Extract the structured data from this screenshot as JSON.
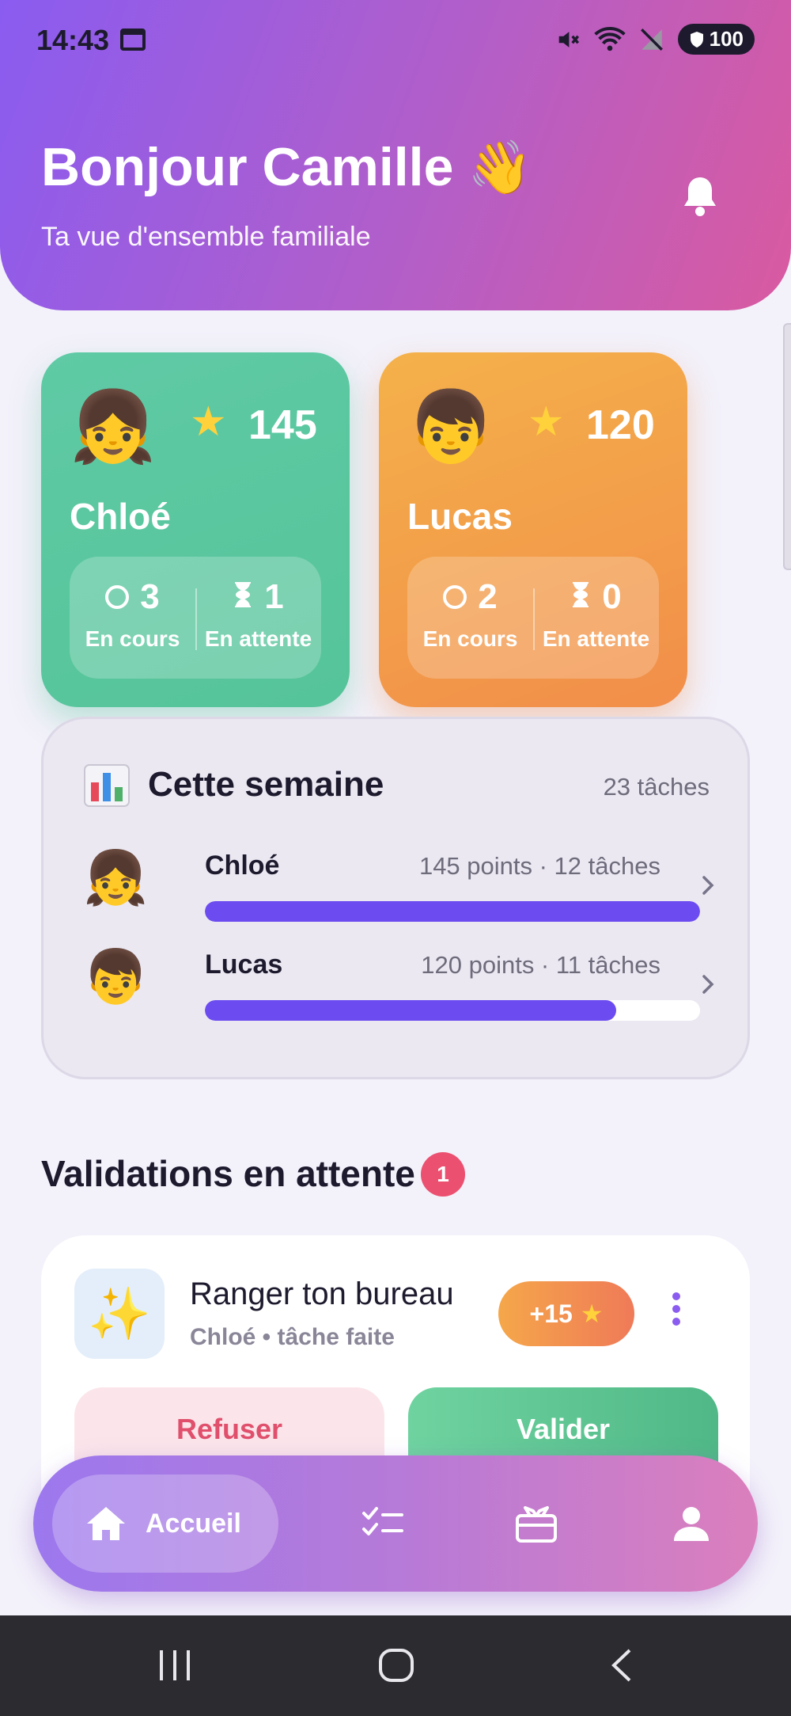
{
  "status_bar": {
    "time": "14:43",
    "battery": "100",
    "icons": [
      "calendar-icon",
      "mute-icon",
      "wifi-icon",
      "no-signal-icon",
      "battery-shield-icon"
    ]
  },
  "header": {
    "greeting": "Bonjour Camille",
    "greeting_icon": "👋",
    "subtitle": "Ta vue d'ensemble familiale",
    "bell_icon": "bell-icon"
  },
  "kids": [
    {
      "name": "Chloé",
      "avatar": "👧",
      "points": "145",
      "in_progress": "3",
      "in_progress_label": "En cours",
      "pending": "1",
      "pending_label": "En attente",
      "color": "#5fcaa5"
    },
    {
      "name": "Lucas",
      "avatar": "👦",
      "points": "120",
      "in_progress": "2",
      "in_progress_label": "En cours",
      "pending": "0",
      "pending_label": "En attente",
      "color": "#f4a54a"
    }
  ],
  "week": {
    "title": "Cette semaine",
    "total": "23 tâches",
    "rows": [
      {
        "name": "Chloé",
        "avatar": "👧",
        "meta": "145 points · 12 tâches",
        "progress": 1.0
      },
      {
        "name": "Lucas",
        "avatar": "👦",
        "meta": "120 points · 11 tâches",
        "progress": 0.83
      }
    ],
    "bar_color": "#6c4cf0"
  },
  "validations": {
    "title": "Validations en attente",
    "count": "1",
    "items": [
      {
        "icon": "✨",
        "title": "Ranger ton bureau",
        "subtitle": "Chloé • tâche faite",
        "points": "+15",
        "refuse_label": "Refuser",
        "validate_label": "Valider"
      }
    ]
  },
  "bottom_nav": {
    "home_label": "Accueil",
    "items": [
      "home-icon",
      "tasks-icon",
      "gift-icon",
      "profile-icon"
    ],
    "active": "Accueil"
  },
  "colors": {
    "accent": "#8a5cf0",
    "pink": "#d95aa0",
    "danger": "#ec5070",
    "success": "#4fb886"
  }
}
